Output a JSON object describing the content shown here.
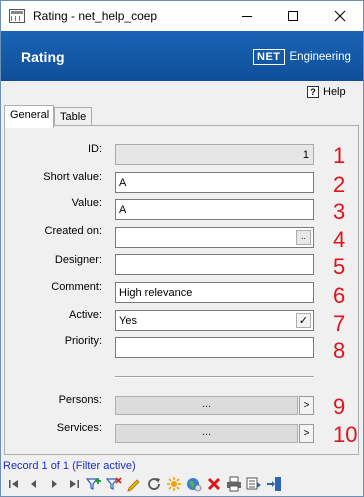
{
  "window": {
    "title": "Rating - net_help_coep"
  },
  "header": {
    "title": "Rating",
    "logo_box": "NET",
    "logo_text": "Engineering"
  },
  "help": {
    "icon_char": "?",
    "label": "Help"
  },
  "tabs": [
    {
      "label": "General",
      "active": true
    },
    {
      "label": "Table",
      "active": false
    }
  ],
  "form": {
    "id": {
      "label": "ID:",
      "value": "1"
    },
    "short_value": {
      "label": "Short value:",
      "value": "A"
    },
    "value": {
      "label": "Value:",
      "value": "A"
    },
    "created_on": {
      "label": "Created on:",
      "value": "",
      "button": ".."
    },
    "designer": {
      "label": "Designer:",
      "value": ""
    },
    "comment": {
      "label": "Comment:",
      "value": "High relevance"
    },
    "active": {
      "label": "Active:",
      "value": "Yes",
      "check": "✓"
    },
    "priority": {
      "label": "Priority:",
      "value": ""
    },
    "persons": {
      "label": "Persons:",
      "value": "...",
      "button": ">"
    },
    "services": {
      "label": "Services:",
      "value": "...",
      "button": ">"
    }
  },
  "annotations": [
    "1",
    "2",
    "3",
    "4",
    "5",
    "6",
    "7",
    "8",
    "9",
    "10"
  ],
  "status": {
    "text": "Record 1 of 1 (Filter active)"
  },
  "toolbar": {
    "icons": [
      "first-record-icon",
      "previous-record-icon",
      "next-record-icon",
      "last-record-icon",
      "add-filter-icon",
      "clear-filter-icon",
      "edit-icon",
      "refresh-icon",
      "new-record-icon",
      "web-icon",
      "delete-icon",
      "print-icon",
      "export-icon",
      "exit-icon"
    ]
  },
  "colors": {
    "banner": "#1a63b5",
    "annotation": "#e0131b",
    "status_text": "#1b2fc9"
  }
}
